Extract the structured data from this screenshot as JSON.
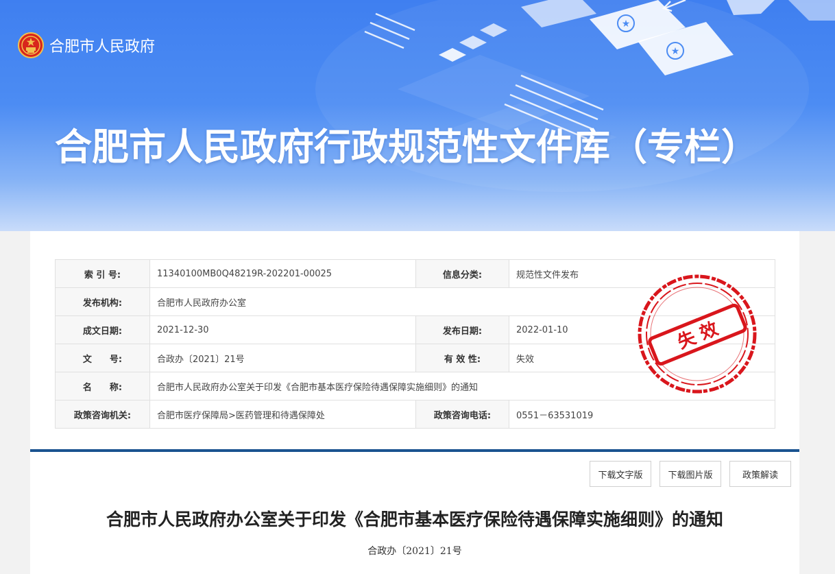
{
  "header": {
    "site_name": "合肥市人民政府",
    "banner_title": "合肥市人民政府行政规范性文件库（专栏）"
  },
  "meta": {
    "index_label": "索 引 号:",
    "index_value": "11340100MB0Q48219R-202201-00025",
    "category_label": "信息分类:",
    "category_value": "规范性文件发布",
    "publisher_label": "发布机构:",
    "publisher_value": "合肥市人民政府办公室",
    "created_label": "成文日期:",
    "created_value": "2021-12-30",
    "published_label": "发布日期:",
    "published_value": "2022-01-10",
    "docno_label": "文　　号:",
    "docno_value": "合政办〔2021〕21号",
    "validity_label": "有 效 性:",
    "validity_value": "失效",
    "name_label": "名　　称:",
    "name_value": "合肥市人民政府办公室关于印发《合肥市基本医疗保险待遇保障实施细则》的通知",
    "consult_org_label": "政策咨询机关:",
    "consult_org_value": "合肥市医疗保障局>医药管理和待遇保障处",
    "consult_phone_label": "政策咨询电话:",
    "consult_phone_value": "0551－63531019"
  },
  "stamp": {
    "text": "失 效",
    "color": "#d9161c"
  },
  "actions": {
    "download_text": "下载文字版",
    "download_image": "下载图片版",
    "policy_reading": "政策解读"
  },
  "document": {
    "title": "合肥市人民政府办公室关于印发《合肥市基本医疗保险待遇保障实施细则》的通知",
    "number": "合政办〔2021〕21号"
  },
  "colors": {
    "banner": "#4c8cf3",
    "divider": "#1a5390"
  }
}
